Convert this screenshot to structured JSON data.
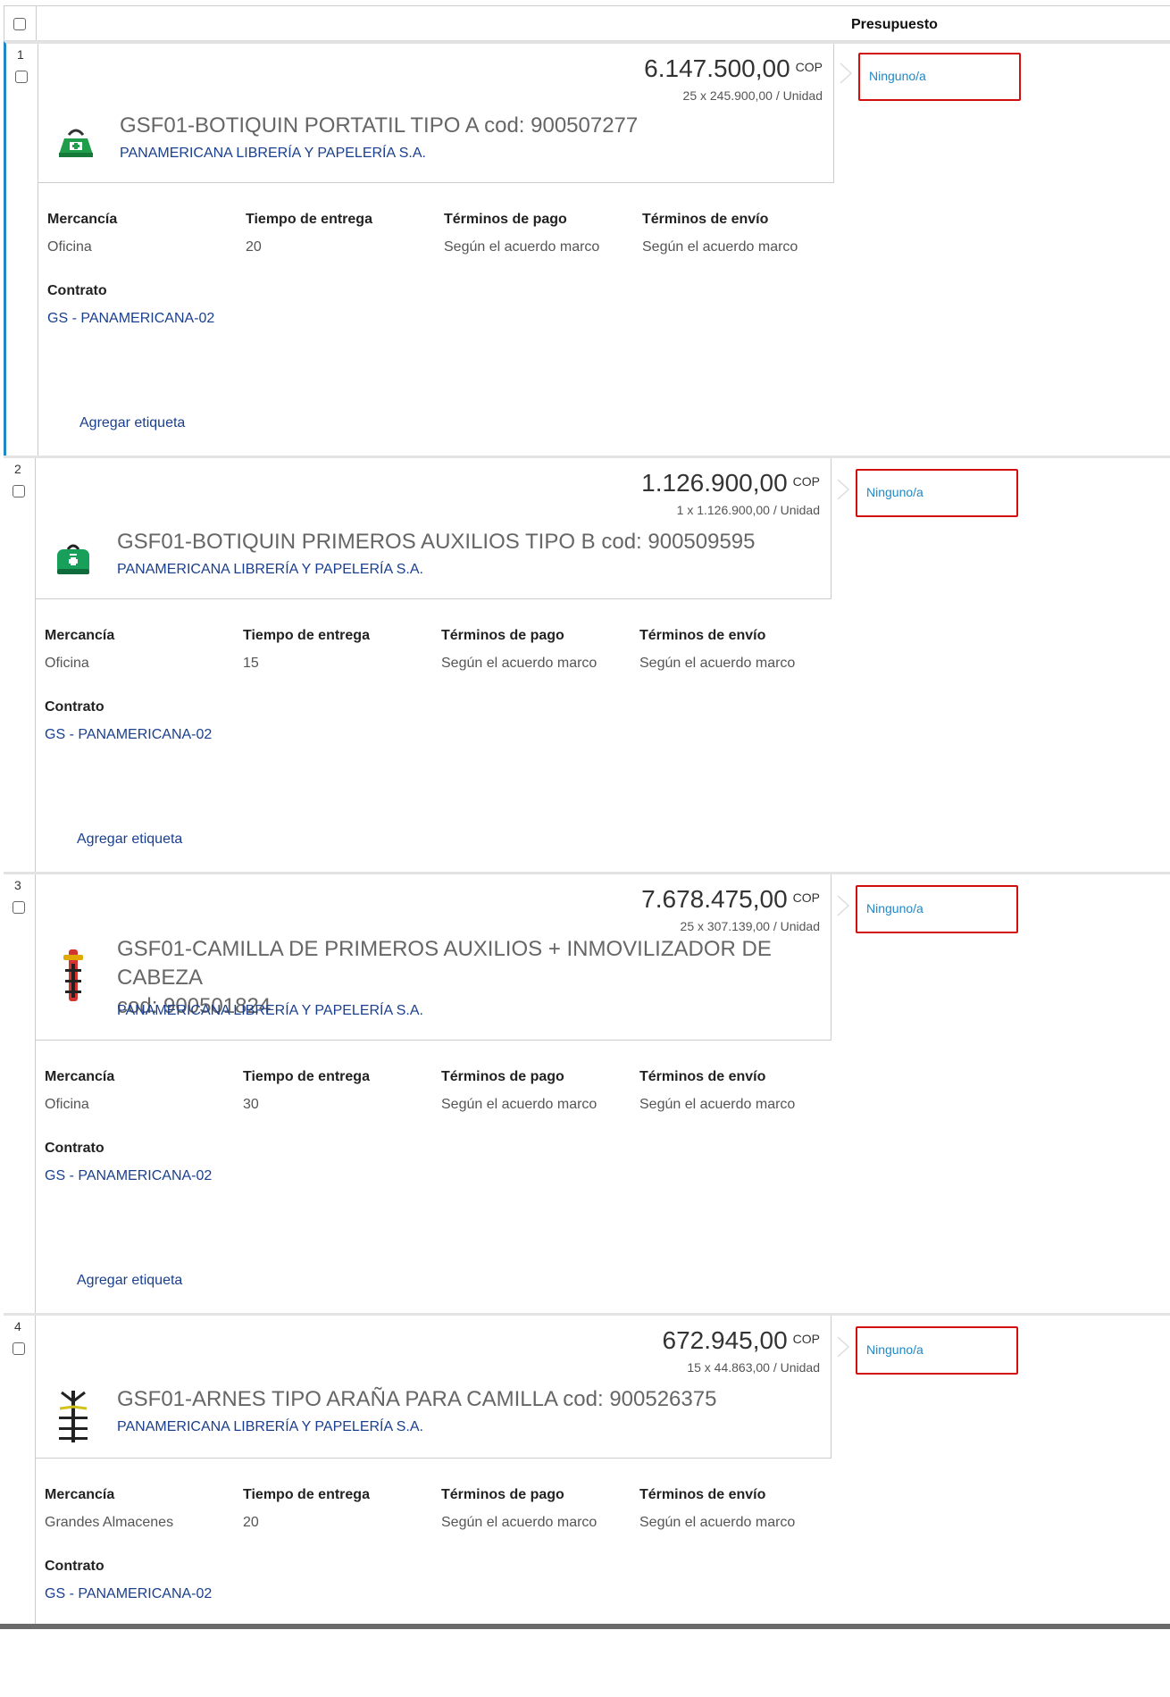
{
  "header": {
    "column_title": "Presupuesto"
  },
  "labels": {
    "merchandise": "Mercancía",
    "delivery": "Tiempo de entrega",
    "payment": "Términos de pago",
    "shipping": "Términos de envío",
    "contract": "Contrato",
    "add_tag": "Agregar etiqueta"
  },
  "items": [
    {
      "number": "1",
      "amount": "6.147.500,00",
      "currency": "COP",
      "unit_line": "25 x 245.900,00 / Unidad",
      "name": "GSF01-BOTIQUIN PORTATIL TIPO A cod: 900507277",
      "supplier": "PANAMERICANA LIBRERÍA Y PAPELERÍA S.A.",
      "budget": "Ninguno/a",
      "merchandise": "Oficina",
      "delivery": "20",
      "payment": "Según el acuerdo marco",
      "shipping": "Según el acuerdo marco",
      "contract": "GS - PANAMERICANA-02",
      "icon": "first-aid-kit-icon"
    },
    {
      "number": "2",
      "amount": "1.126.900,00",
      "currency": "COP",
      "unit_line": "1 x 1.126.900,00 / Unidad",
      "name": "GSF01-BOTIQUIN PRIMEROS AUXILIOS TIPO B cod: 900509595",
      "supplier": "PANAMERICANA LIBRERÍA Y PAPELERÍA S.A.",
      "budget": "Ninguno/a",
      "merchandise": "Oficina",
      "delivery": "15",
      "payment": "Según el acuerdo marco",
      "shipping": "Según el acuerdo marco",
      "contract": "GS - PANAMERICANA-02",
      "icon": "first-aid-bag-icon"
    },
    {
      "number": "3",
      "amount": "7.678.475,00",
      "currency": "COP",
      "unit_line": "25 x 307.139,00 / Unidad",
      "name_line1": "GSF01-CAMILLA DE PRIMEROS AUXILIOS + INMOVILIZADOR DE CABEZA",
      "name_line2": "cod: 900501824",
      "supplier": "PANAMERICANA LIBRERÍA Y PAPELERÍA S.A.",
      "budget": "Ninguno/a",
      "merchandise": "Oficina",
      "delivery": "30",
      "payment": "Según el acuerdo marco",
      "shipping": "Según el acuerdo marco",
      "contract": "GS - PANAMERICANA-02",
      "icon": "stretcher-icon"
    },
    {
      "number": "4",
      "amount": "672.945,00",
      "currency": "COP",
      "unit_line": "15 x 44.863,00 / Unidad",
      "name": "GSF01-ARNES TIPO ARAÑA PARA CAMILLA cod: 900526375",
      "supplier": "PANAMERICANA LIBRERÍA Y PAPELERÍA S.A.",
      "budget": "Ninguno/a",
      "merchandise": "Grandes Almacenes",
      "delivery": "20",
      "payment": "Según el acuerdo marco",
      "shipping": "Según el acuerdo marco",
      "contract": "GS - PANAMERICANA-02",
      "icon": "spider-harness-icon"
    }
  ],
  "colors": {
    "link": "#1a3f8f",
    "budget_border": "#d30e0e",
    "active_row": "#1f88c7",
    "budget_text": "#1f88c7"
  }
}
